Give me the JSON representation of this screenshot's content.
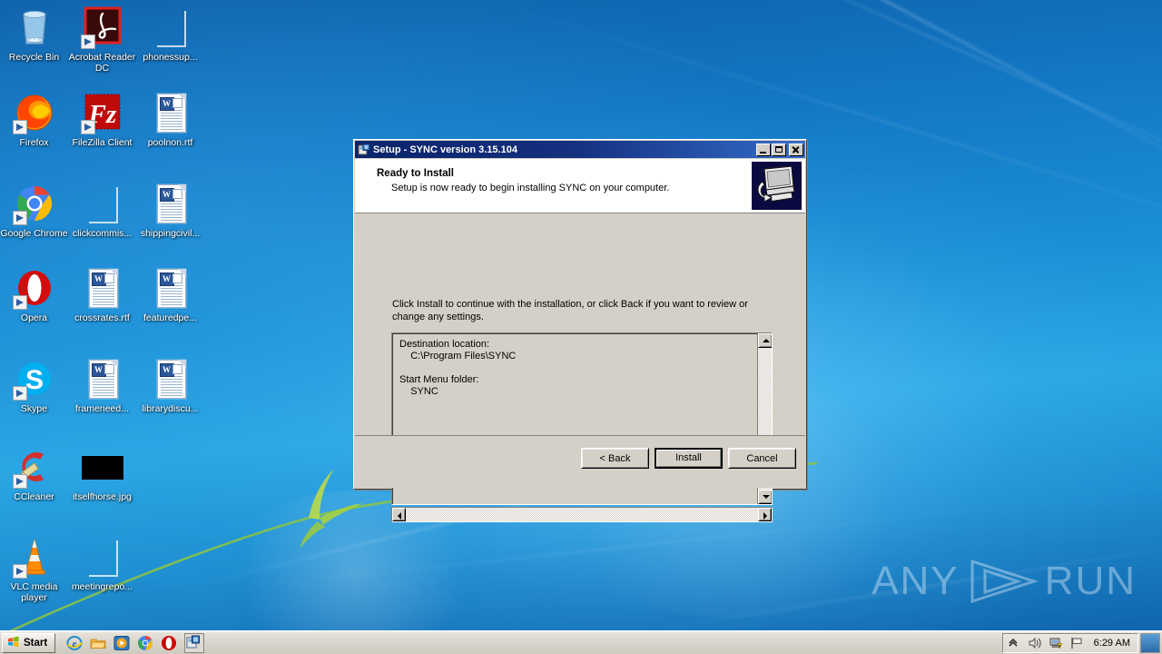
{
  "desktop": {
    "icons": [
      {
        "label": "Recycle Bin",
        "type": "recycle",
        "col": 0,
        "row": 0,
        "shortcut": false
      },
      {
        "label": "Acrobat Reader DC",
        "type": "acrobat",
        "col": 1,
        "row": 0,
        "shortcut": true
      },
      {
        "label": "phonessup...",
        "type": "blank",
        "col": 2,
        "row": 0,
        "shortcut": false
      },
      {
        "label": "Firefox",
        "type": "firefox",
        "col": 0,
        "row": 1,
        "shortcut": true
      },
      {
        "label": "FileZilla Client",
        "type": "filezilla",
        "col": 1,
        "row": 1,
        "shortcut": true
      },
      {
        "label": "poolnon.rtf",
        "type": "doc",
        "col": 2,
        "row": 1,
        "shortcut": false
      },
      {
        "label": "Google Chrome",
        "type": "chrome",
        "col": 0,
        "row": 2,
        "shortcut": true
      },
      {
        "label": "clickcommis...",
        "type": "blank",
        "col": 1,
        "row": 2,
        "shortcut": false
      },
      {
        "label": "shippingcivil...",
        "type": "doc",
        "col": 2,
        "row": 2,
        "shortcut": false
      },
      {
        "label": "Opera",
        "type": "opera",
        "col": 0,
        "row": 3,
        "shortcut": true
      },
      {
        "label": "crossrates.rtf",
        "type": "doc",
        "col": 1,
        "row": 3,
        "shortcut": false
      },
      {
        "label": "featuredpe...",
        "type": "doc",
        "col": 2,
        "row": 3,
        "shortcut": false
      },
      {
        "label": "Skype",
        "type": "skype",
        "col": 0,
        "row": 4,
        "shortcut": true
      },
      {
        "label": "frameneed...",
        "type": "doc",
        "col": 1,
        "row": 4,
        "shortcut": false
      },
      {
        "label": "librarydiscu...",
        "type": "doc",
        "col": 2,
        "row": 4,
        "shortcut": false
      },
      {
        "label": "CCleaner",
        "type": "ccleaner",
        "col": 0,
        "row": 5,
        "shortcut": true
      },
      {
        "label": "itselfhorse.jpg",
        "type": "blackimg",
        "col": 1,
        "row": 5,
        "shortcut": false
      },
      {
        "label": "VLC media player",
        "type": "vlc",
        "col": 0,
        "row": 6,
        "shortcut": true
      },
      {
        "label": "meetingrepo...",
        "type": "blank",
        "col": 1,
        "row": 6,
        "shortcut": false
      }
    ],
    "watermark": {
      "left_text": "ANY",
      "right_text": "RUN"
    }
  },
  "taskbar": {
    "start_label": "Start",
    "quicklaunch": [
      {
        "name": "internet-explorer-icon"
      },
      {
        "name": "windows-explorer-icon"
      },
      {
        "name": "media-player-icon"
      },
      {
        "name": "google-chrome-icon"
      },
      {
        "name": "opera-icon"
      }
    ],
    "tasks": [
      {
        "name": "setup-sync-task",
        "title": "Setup - SYNC version 3.15.104"
      }
    ],
    "tray": {
      "show_hidden_icons": "show-hidden-icons-chevron",
      "volume": "volume-speaker-icon",
      "network": "network-warning-icon",
      "action_center": "flag-icon",
      "clock": "6:29 AM",
      "show_desktop": "show-desktop-button"
    }
  },
  "dialog": {
    "title": "Setup - SYNC version 3.15.104",
    "title_icon": "setup-installer-icon",
    "window_buttons": {
      "minimize": "minimize-button",
      "maximize": "maximize-button",
      "close": "close-button"
    },
    "header": {
      "title": "Ready to Install",
      "subtitle": "Setup is now ready to begin installing SYNC on your computer.",
      "icon": "monitor-install-icon"
    },
    "body": {
      "instruction": "Click Install to continue with the installation, or click Back if you want to review or change any settings.",
      "details": "Destination location:\n    C:\\Program Files\\SYNC\n\nStart Menu folder:\n    SYNC"
    },
    "buttons": {
      "back": "< Back",
      "install": "Install",
      "cancel": "Cancel"
    }
  }
}
